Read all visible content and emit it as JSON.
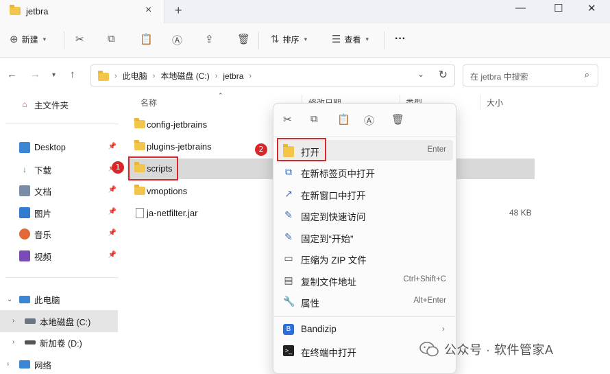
{
  "window": {
    "tab_title": "jetbra",
    "new_tab": "+",
    "minimize": "—",
    "maximize": "☐",
    "close": "✕"
  },
  "toolbar": {
    "new_label": "新建",
    "sort_label": "排序",
    "view_label": "查看",
    "more_label": "···"
  },
  "address": {
    "crumbs": [
      "此电脑",
      "本地磁盘 (C:)",
      "jetbra"
    ],
    "search_placeholder": "在 jetbra 中搜索"
  },
  "sidebar": {
    "home": "主文件夹",
    "pinned": [
      "Desktop",
      "下载",
      "文档",
      "图片",
      "音乐",
      "视频"
    ],
    "this_pc": "此电脑",
    "drives": [
      "本地磁盘 (C:)",
      "新加卷 (D:)"
    ],
    "network": "网络"
  },
  "columns": {
    "name": "名称",
    "modified": "修改日期",
    "type": "类型",
    "size": "大小"
  },
  "files": [
    {
      "name": "config-jetbrains",
      "kind": "folder",
      "size": ""
    },
    {
      "name": "plugins-jetbrains",
      "kind": "folder",
      "size": ""
    },
    {
      "name": "scripts",
      "kind": "folder",
      "size": ""
    },
    {
      "name": "vmoptions",
      "kind": "folder",
      "size": ""
    },
    {
      "name": "ja-netfilter.jar",
      "kind": "file",
      "size": "48 KB"
    }
  ],
  "annotations": {
    "badge1": "1",
    "badge2": "2"
  },
  "context_menu": {
    "items": [
      {
        "label": "打开",
        "shortcut": "Enter",
        "icon": "folder-icon"
      },
      {
        "label": "在新标签页中打开",
        "shortcut": "",
        "icon": "open-new-tab-icon"
      },
      {
        "label": "在新窗口中打开",
        "shortcut": "",
        "icon": "open-new-window-icon"
      },
      {
        "label": "固定到快速访问",
        "shortcut": "",
        "icon": "pin-icon"
      },
      {
        "label": "固定到“开始”",
        "shortcut": "",
        "icon": "pin-icon"
      },
      {
        "label": "压缩为 ZIP 文件",
        "shortcut": "",
        "icon": "zip-icon"
      },
      {
        "label": "复制文件地址",
        "shortcut": "Ctrl+Shift+C",
        "icon": "copy-path-icon"
      },
      {
        "label": "属性",
        "shortcut": "Alt+Enter",
        "icon": "properties-icon"
      }
    ],
    "extra": [
      {
        "label": "Bandizip",
        "icon": "bandizip-icon"
      },
      {
        "label": "在终端中打开",
        "icon": "terminal-icon"
      }
    ]
  },
  "watermark": {
    "text": "公众号 · 软件管家A"
  },
  "colors": {
    "accent_red": "#d8262b",
    "folder_yellow": "#f3c64b",
    "selection_gray": "#d9d9d9"
  }
}
